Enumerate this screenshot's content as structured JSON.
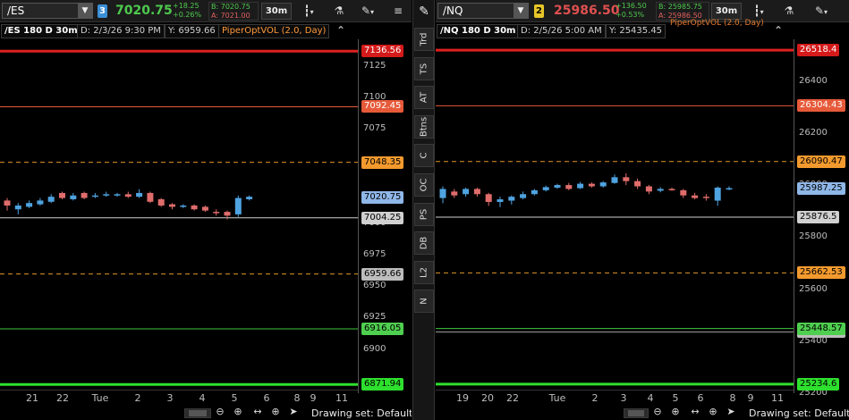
{
  "colors": {
    "up": "#4fa3e0",
    "down": "#e06c6c",
    "green": "#4ec94e",
    "bid": "#4ec94e",
    "ask": "#e06060",
    "ind": "#ff9a3c"
  },
  "left": {
    "symbol": "/ES",
    "link": "3",
    "link_color": "#3b8fd6",
    "price": "7020.75",
    "price_color": "#4ec94e",
    "change_abs": "+18.25",
    "change_pct": "+0.26%",
    "bid": "B: 7020.75",
    "ask": "A: 7021.00",
    "timeframe": "30m",
    "chart_title": "/ES 180 D 30m",
    "date_label": "D: 2/3/26 9:30 PM",
    "y_label": "Y: 6959.66",
    "study_label": "PiperOptVOL (2.0, Day)",
    "axis_min": 6865,
    "axis_max": 7146,
    "ticks": [
      "7125",
      "7100",
      "7075",
      "7000",
      "6975",
      "6950",
      "6925",
      "6900"
    ],
    "tick_values": [
      7125,
      7100,
      7075,
      7000,
      6975,
      6950,
      6925,
      6900
    ],
    "xlabels": [
      "21",
      "22",
      "Tue",
      "2",
      "3",
      "4",
      "5",
      "6",
      "8",
      "9",
      "11"
    ],
    "xlabel_pos": [
      0.09,
      0.175,
      0.28,
      0.385,
      0.475,
      0.565,
      0.655,
      0.745,
      0.83,
      0.875,
      0.955
    ],
    "levels": [
      {
        "value": 7136.56,
        "label": "7136.56",
        "color": "#e02020",
        "bg": "#d41a1a",
        "fg": "#fff",
        "width": 3,
        "dash": ""
      },
      {
        "value": 7092.45,
        "label": "7092.45",
        "color": "#e65a3a",
        "bg": "#e65a3a",
        "fg": "#fff",
        "width": 1,
        "dash": ""
      },
      {
        "value": 7048.35,
        "label": "7048.35",
        "color": "#e0962a",
        "bg": "#f39a2e",
        "fg": "#000",
        "width": 1,
        "dash": "5,4"
      },
      {
        "value": 7020.75,
        "label": "7020.75",
        "color": "#4fa3e0",
        "bg": "#8fb7e8",
        "fg": "#000",
        "width": 0,
        "dash": ""
      },
      {
        "value": 7004.25,
        "label": "7004.25",
        "color": "#cfcfcf",
        "bg": "#d0d0d0",
        "fg": "#000",
        "width": 1,
        "dash": ""
      },
      {
        "value": 6959.66,
        "label": "6959.66",
        "color": "#e0962a",
        "bg": "#bdbdbd",
        "fg": "#000",
        "width": 1,
        "dash": "5,4"
      },
      {
        "value": 6916.05,
        "label": "6916.05",
        "color": "#3cc93c",
        "bg": "#4fcf4f",
        "fg": "#000",
        "width": 1,
        "dash": ""
      },
      {
        "value": 6871.94,
        "label": "6871.94",
        "color": "#2ee02e",
        "bg": "#2ee02e",
        "fg": "#000",
        "width": 3,
        "dash": ""
      }
    ],
    "candles": [
      {
        "o": 7018,
        "c": 7014,
        "h": 7020,
        "l": 7010
      },
      {
        "o": 7011,
        "c": 7014,
        "h": 7016,
        "l": 7007
      },
      {
        "o": 7013,
        "c": 7016,
        "h": 7018,
        "l": 7012
      },
      {
        "o": 7015,
        "c": 7018,
        "h": 7020,
        "l": 7014
      },
      {
        "o": 7017,
        "c": 7021,
        "h": 7023,
        "l": 7016
      },
      {
        "o": 7024,
        "c": 7020,
        "h": 7025,
        "l": 7019
      },
      {
        "o": 7019,
        "c": 7022,
        "h": 7024,
        "l": 7018
      },
      {
        "o": 7024,
        "c": 7020,
        "h": 7025,
        "l": 7019
      },
      {
        "o": 7021,
        "c": 7022,
        "h": 7024,
        "l": 7020
      },
      {
        "o": 7022,
        "c": 7023,
        "h": 7025,
        "l": 7021
      },
      {
        "o": 7022,
        "c": 7023,
        "h": 7024,
        "l": 7021
      },
      {
        "o": 7023,
        "c": 7021,
        "h": 7025,
        "l": 7020
      },
      {
        "o": 7021,
        "c": 7024,
        "h": 7027,
        "l": 7020
      },
      {
        "o": 7024,
        "c": 7017,
        "h": 7025,
        "l": 7016
      },
      {
        "o": 7019,
        "c": 7014,
        "h": 7020,
        "l": 7013
      },
      {
        "o": 7015,
        "c": 7013,
        "h": 7016,
        "l": 7011
      },
      {
        "o": 7013,
        "c": 7014,
        "h": 7015,
        "l": 7012
      },
      {
        "o": 7014,
        "c": 7011,
        "h": 7015,
        "l": 7010
      },
      {
        "o": 7013,
        "c": 7010,
        "h": 7014,
        "l": 7009
      },
      {
        "o": 7009,
        "c": 7008,
        "h": 7011,
        "l": 7006
      },
      {
        "o": 7009,
        "c": 7006,
        "h": 7010,
        "l": 7003
      },
      {
        "o": 7007,
        "c": 7020,
        "h": 7022,
        "l": 7005
      },
      {
        "o": 7019,
        "c": 7021,
        "h": 7022,
        "l": 7018
      }
    ]
  },
  "right": {
    "symbol": "/NQ",
    "link": "2",
    "link_color": "#e8c629",
    "price": "25986.50",
    "price_color": "#e05050",
    "change_abs": "+136.50",
    "change_pct": "+0.53%",
    "bid": "B: 25985.75",
    "ask": "A: 25986.50",
    "timeframe": "30m",
    "chart_title": "/NQ 180 D 30m",
    "date_label": "D: 2/5/26 5:00 AM",
    "y_label": "Y: 25435.45",
    "overlay_text": "PiperOptVOL (2.0, Day)",
    "axis_min": 25200,
    "axis_max": 26560,
    "ticks": [
      "26400",
      "26200",
      "26000",
      "25800",
      "25600",
      "25400",
      "25200"
    ],
    "tick_values": [
      26400,
      26200,
      26000,
      25800,
      25600,
      25400,
      25200
    ],
    "xlabels": [
      "19",
      "20",
      "22",
      "Tue",
      "2",
      "3",
      "4",
      "5",
      "6",
      "8",
      "9",
      "11"
    ],
    "xlabel_pos": [
      0.075,
      0.145,
      0.215,
      0.34,
      0.445,
      0.525,
      0.6,
      0.67,
      0.74,
      0.83,
      0.88,
      0.955
    ],
    "levels": [
      {
        "value": 26518.4,
        "label": "26518.4",
        "color": "#e02020",
        "bg": "#d41a1a",
        "fg": "#fff",
        "width": 3,
        "dash": ""
      },
      {
        "value": 26304.43,
        "label": "26304.43",
        "color": "#e65a3a",
        "bg": "#e65a3a",
        "fg": "#fff",
        "width": 1,
        "dash": ""
      },
      {
        "value": 26090.47,
        "label": "26090.47",
        "color": "#e0962a",
        "bg": "#f39a2e",
        "fg": "#000",
        "width": 1,
        "dash": "5,4"
      },
      {
        "value": 25987.25,
        "label": "25987.25",
        "color": "#4fa3e0",
        "bg": "#8fb7e8",
        "fg": "#000",
        "width": 0,
        "dash": ""
      },
      {
        "value": 25876.5,
        "label": "25876.5",
        "color": "#cfcfcf",
        "bg": "#d0d0d0",
        "fg": "#000",
        "width": 1,
        "dash": ""
      },
      {
        "value": 25662.53,
        "label": "25662.53",
        "color": "#e0962a",
        "bg": "#f39a2e",
        "fg": "#000",
        "width": 1,
        "dash": "5,4"
      },
      {
        "value": 25435.45,
        "label": "25435.45",
        "color": "#9a9a9a",
        "bg": "#bdbdbd",
        "fg": "#000",
        "width": 1,
        "dash": ""
      },
      {
        "value": 25448.57,
        "label": "25448.57",
        "color": "#3cc93c",
        "bg": "#4fcf4f",
        "fg": "#000",
        "width": 1,
        "dash": ""
      },
      {
        "value": 25234.6,
        "label": "25234.6",
        "color": "#2ee02e",
        "bg": "#2ee02e",
        "fg": "#000",
        "width": 3,
        "dash": ""
      }
    ],
    "candles": [
      {
        "o": 25950,
        "c": 25985,
        "h": 25995,
        "l": 25930
      },
      {
        "o": 25975,
        "c": 25960,
        "h": 25985,
        "l": 25950
      },
      {
        "o": 25965,
        "c": 25985,
        "h": 25990,
        "l": 25955
      },
      {
        "o": 25985,
        "c": 25965,
        "h": 25990,
        "l": 25955
      },
      {
        "o": 25965,
        "c": 25935,
        "h": 25970,
        "l": 25920
      },
      {
        "o": 25935,
        "c": 25945,
        "h": 25955,
        "l": 25915
      },
      {
        "o": 25940,
        "c": 25955,
        "h": 25960,
        "l": 25925
      },
      {
        "o": 25950,
        "c": 25965,
        "h": 25975,
        "l": 25945
      },
      {
        "o": 25965,
        "c": 25980,
        "h": 25985,
        "l": 25960
      },
      {
        "o": 25980,
        "c": 25992,
        "h": 25998,
        "l": 25975
      },
      {
        "o": 25990,
        "c": 26000,
        "h": 26005,
        "l": 25985
      },
      {
        "o": 26000,
        "c": 25985,
        "h": 26008,
        "l": 25980
      },
      {
        "o": 25988,
        "c": 26005,
        "h": 26012,
        "l": 25985
      },
      {
        "o": 26005,
        "c": 25995,
        "h": 26010,
        "l": 25990
      },
      {
        "o": 25995,
        "c": 26010,
        "h": 26015,
        "l": 25990
      },
      {
        "o": 26008,
        "c": 26030,
        "h": 26040,
        "l": 26005
      },
      {
        "o": 26030,
        "c": 26015,
        "h": 26045,
        "l": 26000
      },
      {
        "o": 26015,
        "c": 25995,
        "h": 26025,
        "l": 25985
      },
      {
        "o": 25995,
        "c": 25975,
        "h": 26000,
        "l": 25965
      },
      {
        "o": 25978,
        "c": 25985,
        "h": 25992,
        "l": 25972
      },
      {
        "o": 25985,
        "c": 25982,
        "h": 25990,
        "l": 25978
      },
      {
        "o": 25980,
        "c": 25960,
        "h": 25985,
        "l": 25950
      },
      {
        "o": 25960,
        "c": 25950,
        "h": 25970,
        "l": 25945
      },
      {
        "o": 25955,
        "c": 25950,
        "h": 25965,
        "l": 25940
      },
      {
        "o": 25940,
        "c": 25990,
        "h": 25995,
        "l": 25920
      },
      {
        "o": 25985,
        "c": 25988,
        "h": 25995,
        "l": 25980
      }
    ]
  },
  "sidebar": {
    "items": [
      "Trd",
      "TS",
      "AT",
      "Btns",
      "C",
      "OC",
      "PS",
      "DB",
      "L2",
      "N"
    ]
  },
  "toolbar": {
    "drawing_set": "Drawing set: Default"
  },
  "icons": {
    "dropdown": "chevron-down-icon",
    "candles": "candlestick-icon",
    "flask": "flask-icon",
    "draw": "drawing-icon",
    "zoom_out": "zoom-out-icon",
    "zoom_in": "zoom-in-icon",
    "pan": "pan-icon",
    "crosshair": "crosshair-icon",
    "cursor": "cursor-icon"
  }
}
